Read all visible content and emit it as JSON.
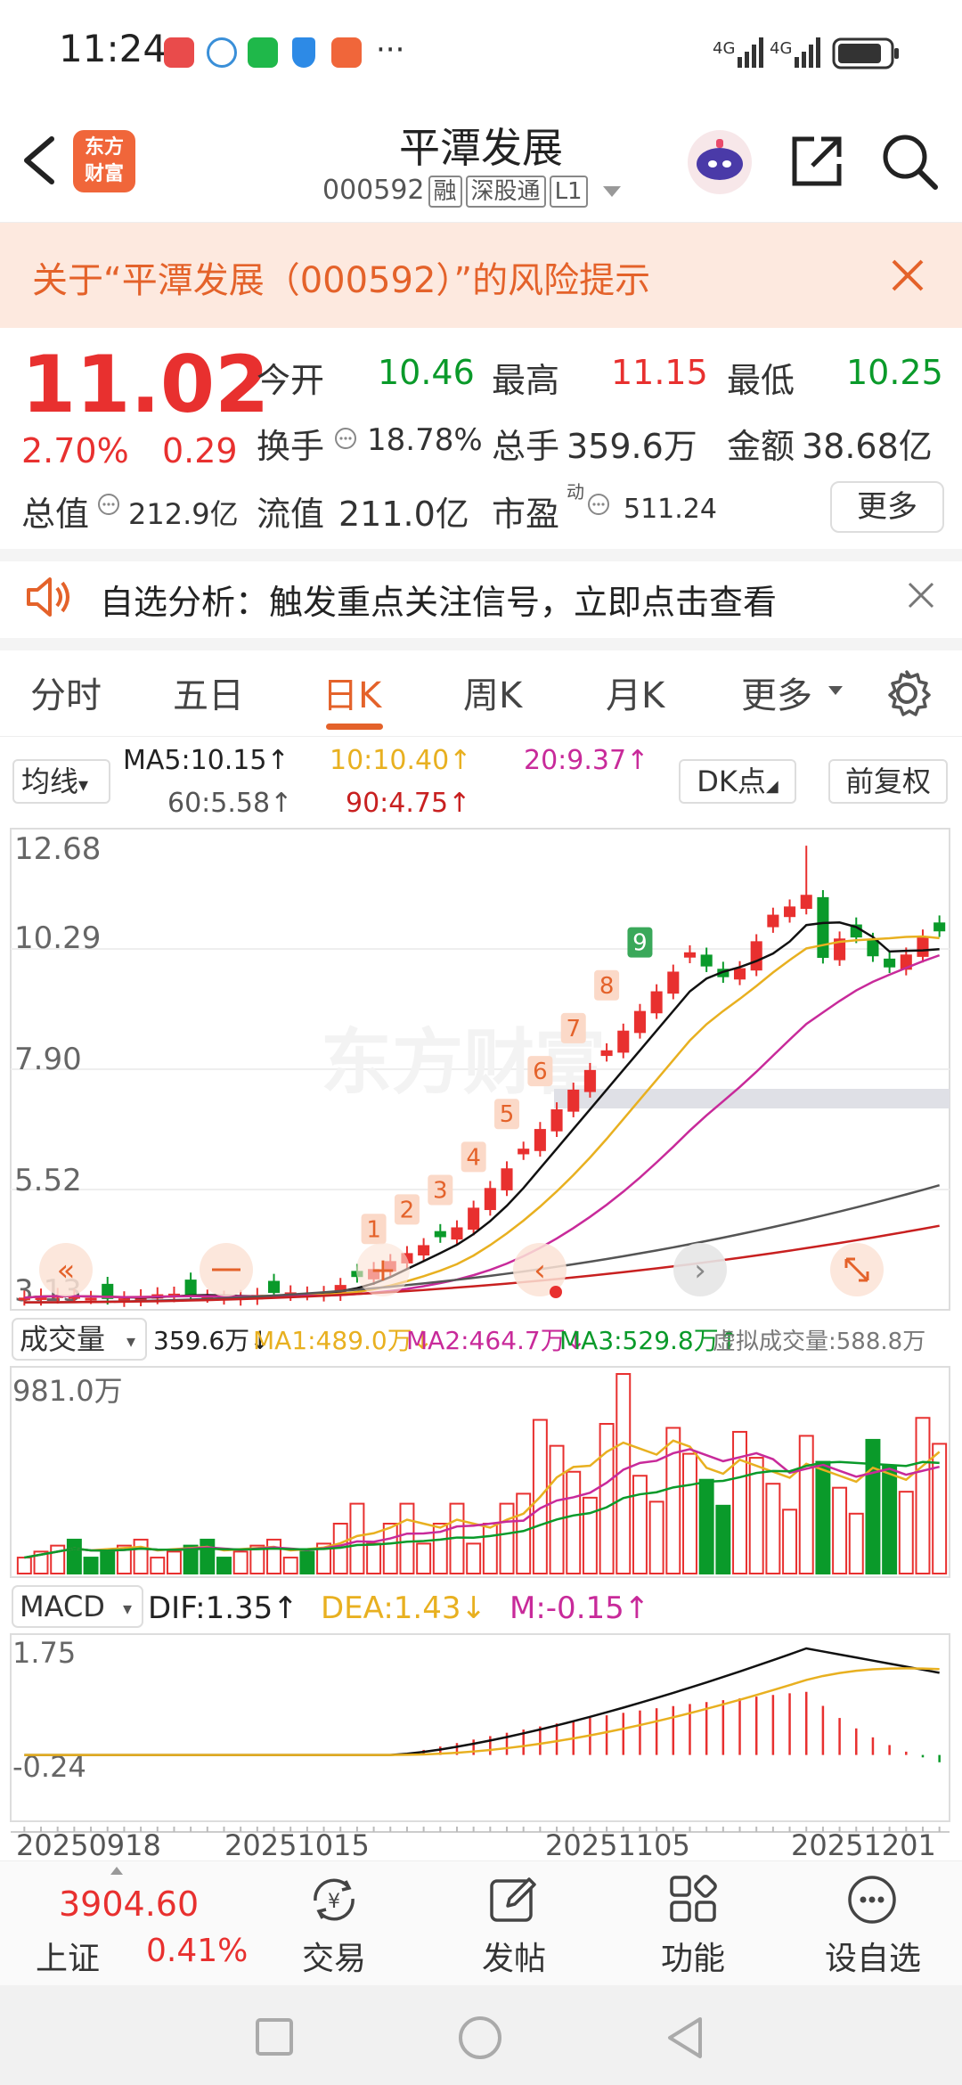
{
  "status": {
    "time": "11:24",
    "dots": "···"
  },
  "header": {
    "title": "平潭发展",
    "code": "000592",
    "tags": [
      "融",
      "深股通",
      "L1"
    ],
    "logo_line1": "东方",
    "logo_line2": "财富"
  },
  "risk": {
    "text": "关于“平潭发展（000592）”的风险提示"
  },
  "quote": {
    "price": "11.02",
    "change_pct": "2.70%",
    "change": "0.29",
    "open_label": "今开",
    "open": "10.46",
    "high_label": "最高",
    "high": "11.15",
    "low_label": "最低",
    "low": "10.25",
    "turnover_label": "换手",
    "turnover": "18.78%",
    "volume_label": "总手",
    "volume": "359.6万",
    "amount_label": "金额",
    "amount": "38.68亿",
    "total_value_label": "总值",
    "total_value": "212.9亿",
    "float_value_label": "流值",
    "float_value": "211.0亿",
    "pe_label": "市盈",
    "pe_sup": "动",
    "pe": "511.24",
    "more_label": "更多"
  },
  "analysis": {
    "text": "自选分析：触发重点关注信号，立即点击查看"
  },
  "tabs": [
    "分时",
    "五日",
    "日K",
    "周K",
    "月K",
    "更多"
  ],
  "ma_row": {
    "selector": "均线",
    "ma5": "MA5:10.15↑",
    "ma10": "10:10.40↑",
    "ma20": "20:9.37↑",
    "ma60": "60:5.58↑",
    "ma90": "90:4.75↑",
    "dk": "DK点",
    "fq": "前复权"
  },
  "kline_axis": [
    "12.68",
    "10.29",
    "7.90",
    "5.52",
    "3.13"
  ],
  "watermark": "东方财富",
  "td_counts": [
    "1",
    "2",
    "3",
    "4",
    "5",
    "6",
    "7",
    "8",
    "9"
  ],
  "volume": {
    "selector": "成交量",
    "value": "359.6万↓",
    "ma1": "MA1:489.0万↓",
    "ma2": "MA2:464.7万↓",
    "ma3": "MA3:529.8万↑",
    "virtual": "虚拟成交量:588.8万",
    "max": "981.0万"
  },
  "macd": {
    "selector": "MACD",
    "dif": "DIF:1.35↑",
    "dea": "DEA:1.43↓",
    "m": "M:-0.15↑",
    "top": "1.75",
    "bottom": "-0.24"
  },
  "dates": [
    "20250918",
    "20251015",
    "20251105",
    "20251201"
  ],
  "index": {
    "value": "3904.60",
    "name": "上证",
    "pct": "0.41%"
  },
  "bottom_nav": [
    "交易",
    "发帖",
    "功能",
    "设自选"
  ],
  "colors": {
    "red": "#e8302f",
    "green": "#0a9a2a",
    "accent": "#e4622a"
  }
}
